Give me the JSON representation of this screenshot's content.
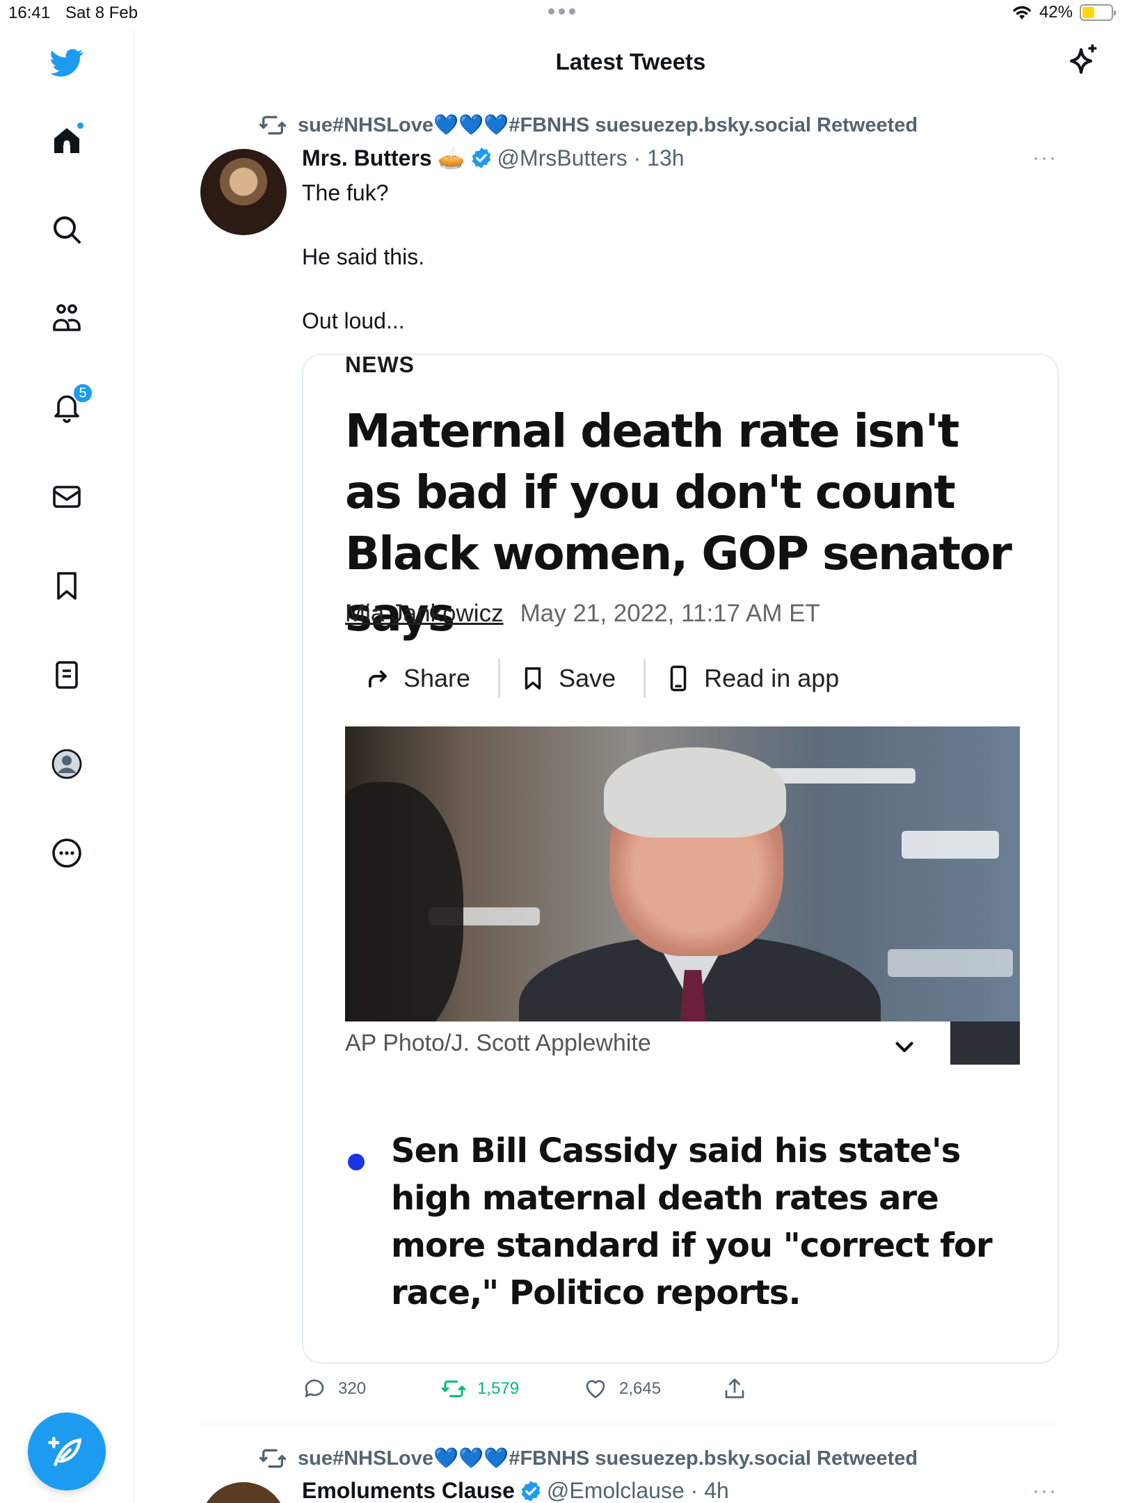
{
  "status_bar": {
    "time": "16:41",
    "date": "Sat 8 Feb",
    "battery_pct": "42%",
    "battery_level": 0.42
  },
  "sidebar": {
    "items": [
      {
        "icon": "twitter-bird-icon"
      },
      {
        "icon": "home-icon",
        "has_dot": true
      },
      {
        "icon": "search-icon"
      },
      {
        "icon": "communities-icon"
      },
      {
        "icon": "notifications-icon",
        "badge": "5"
      },
      {
        "icon": "messages-icon"
      },
      {
        "icon": "bookmarks-icon"
      },
      {
        "icon": "lists-icon"
      },
      {
        "icon": "profile-icon"
      },
      {
        "icon": "more-icon"
      }
    ],
    "compose_icon": "compose-feather-icon"
  },
  "header": {
    "title": "Latest Tweets",
    "sparkle_icon": "sparkle-icon"
  },
  "tweets": [
    {
      "retweeted_by": "sue#NHSLove💙💙💙#FBNHS suesuezep.bsky.social Retweeted",
      "name": "Mrs. Butters",
      "name_emoji": "🥧",
      "handle_time": "@MrsButters · 13h",
      "more": "···",
      "text_lines": [
        "The fuk?",
        "He said this.",
        "Out loud..."
      ],
      "card": {
        "section": "NEWS",
        "headline": "Maternal death rate isn't as bad if you don't count Black women, GOP senator says",
        "author": "Mia Jankowicz",
        "date": "May 21, 2022, 11:17 AM ET",
        "actions": [
          "Share",
          "Save",
          "Read in app"
        ],
        "photo_caption": "AP Photo/J. Scott Applewhite",
        "bullet": "Sen Bill Cassidy said his state's high maternal death rates are more standard if you \"correct for race,\" Politico reports."
      },
      "replies": "320",
      "retweets": "1,579",
      "likes": "2,645"
    },
    {
      "retweeted_by": "sue#NHSLove💙💙💙#FBNHS suesuezep.bsky.social Retweeted",
      "name": "Emoluments Clause",
      "handle_time": "@Emolclause · 4h",
      "more": "···"
    }
  ],
  "colors": {
    "accent": "#1d9bf0",
    "retweet_active": "#00ba7c",
    "secondary_text": "#536471",
    "bullet": "#1a35e6"
  }
}
